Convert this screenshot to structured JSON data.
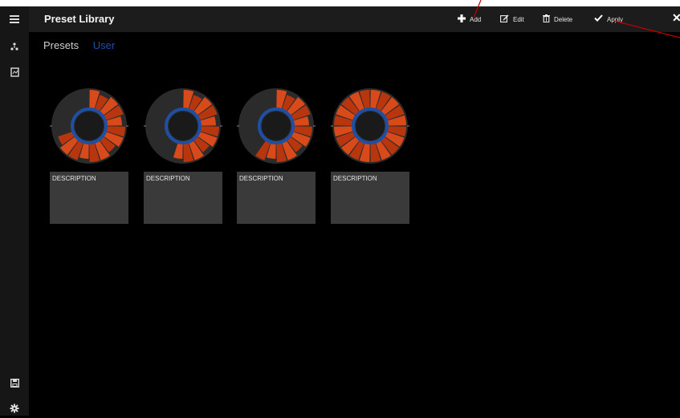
{
  "header": {
    "title": "Preset Library",
    "add_label": "Add",
    "edit_label": "Edit",
    "delete_label": "Delete",
    "apply_label": "Apply"
  },
  "sidebar": {
    "icons": [
      "menu-icon",
      "network-icon",
      "document-icon",
      "save-icon",
      "gear-icon"
    ]
  },
  "tabs": [
    {
      "label": "Presets",
      "active": false
    },
    {
      "label": "User",
      "active": true
    }
  ],
  "presets": [
    {
      "description": "DESCRIPTION",
      "fill": 0.72
    },
    {
      "description": "DESCRIPTION",
      "fill": 0.55
    },
    {
      "description": "DESCRIPTION",
      "fill": 0.6
    },
    {
      "description": "DESCRIPTION",
      "fill": 1.0
    }
  ],
  "colors": {
    "segment": "#d94a1a",
    "segment_dark": "#b8360e",
    "ring": "#1f4fa3",
    "track": "#2b2b2b",
    "accent_user_tab": "#1f4fa3",
    "annotation": "#c00000"
  }
}
